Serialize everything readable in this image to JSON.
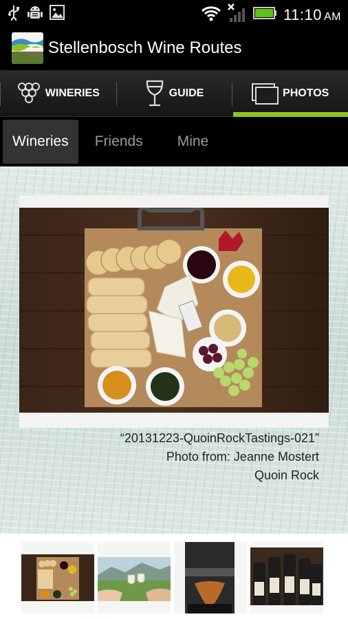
{
  "status_bar": {
    "time": "11:10",
    "ampm": "AM",
    "icons": [
      "usb-icon",
      "android-debug-icon",
      "gallery-icon",
      "wifi-icon",
      "no-signal-icon",
      "battery-icon"
    ]
  },
  "app": {
    "title": "Stellenbosch Wine Routes",
    "logo_icon": "stellenbosch-logo"
  },
  "main_tabs": [
    {
      "label": "WINERIES",
      "icon": "grapes-icon",
      "active": false
    },
    {
      "label": "GUIDE",
      "icon": "wine-glass-icon",
      "active": false
    },
    {
      "label": "PHOTOS",
      "icon": "photos-icon",
      "active": true
    }
  ],
  "sub_tabs": [
    {
      "label": "Wineries",
      "active": true
    },
    {
      "label": "Friends",
      "active": false
    },
    {
      "label": "Mine",
      "active": false
    }
  ],
  "photo": {
    "title": "“20131223-QuoinRockTastings-021”",
    "credit": "Photo from: Jeanne Mostert",
    "winery": "Quoin Rock"
  },
  "colors": {
    "accent": "#8fc31f",
    "background": "#000000"
  },
  "thumbnails": [
    {
      "name": "thumb-platter"
    },
    {
      "name": "thumb-toast"
    },
    {
      "name": "thumb-pour"
    },
    {
      "name": "thumb-bottles"
    }
  ]
}
